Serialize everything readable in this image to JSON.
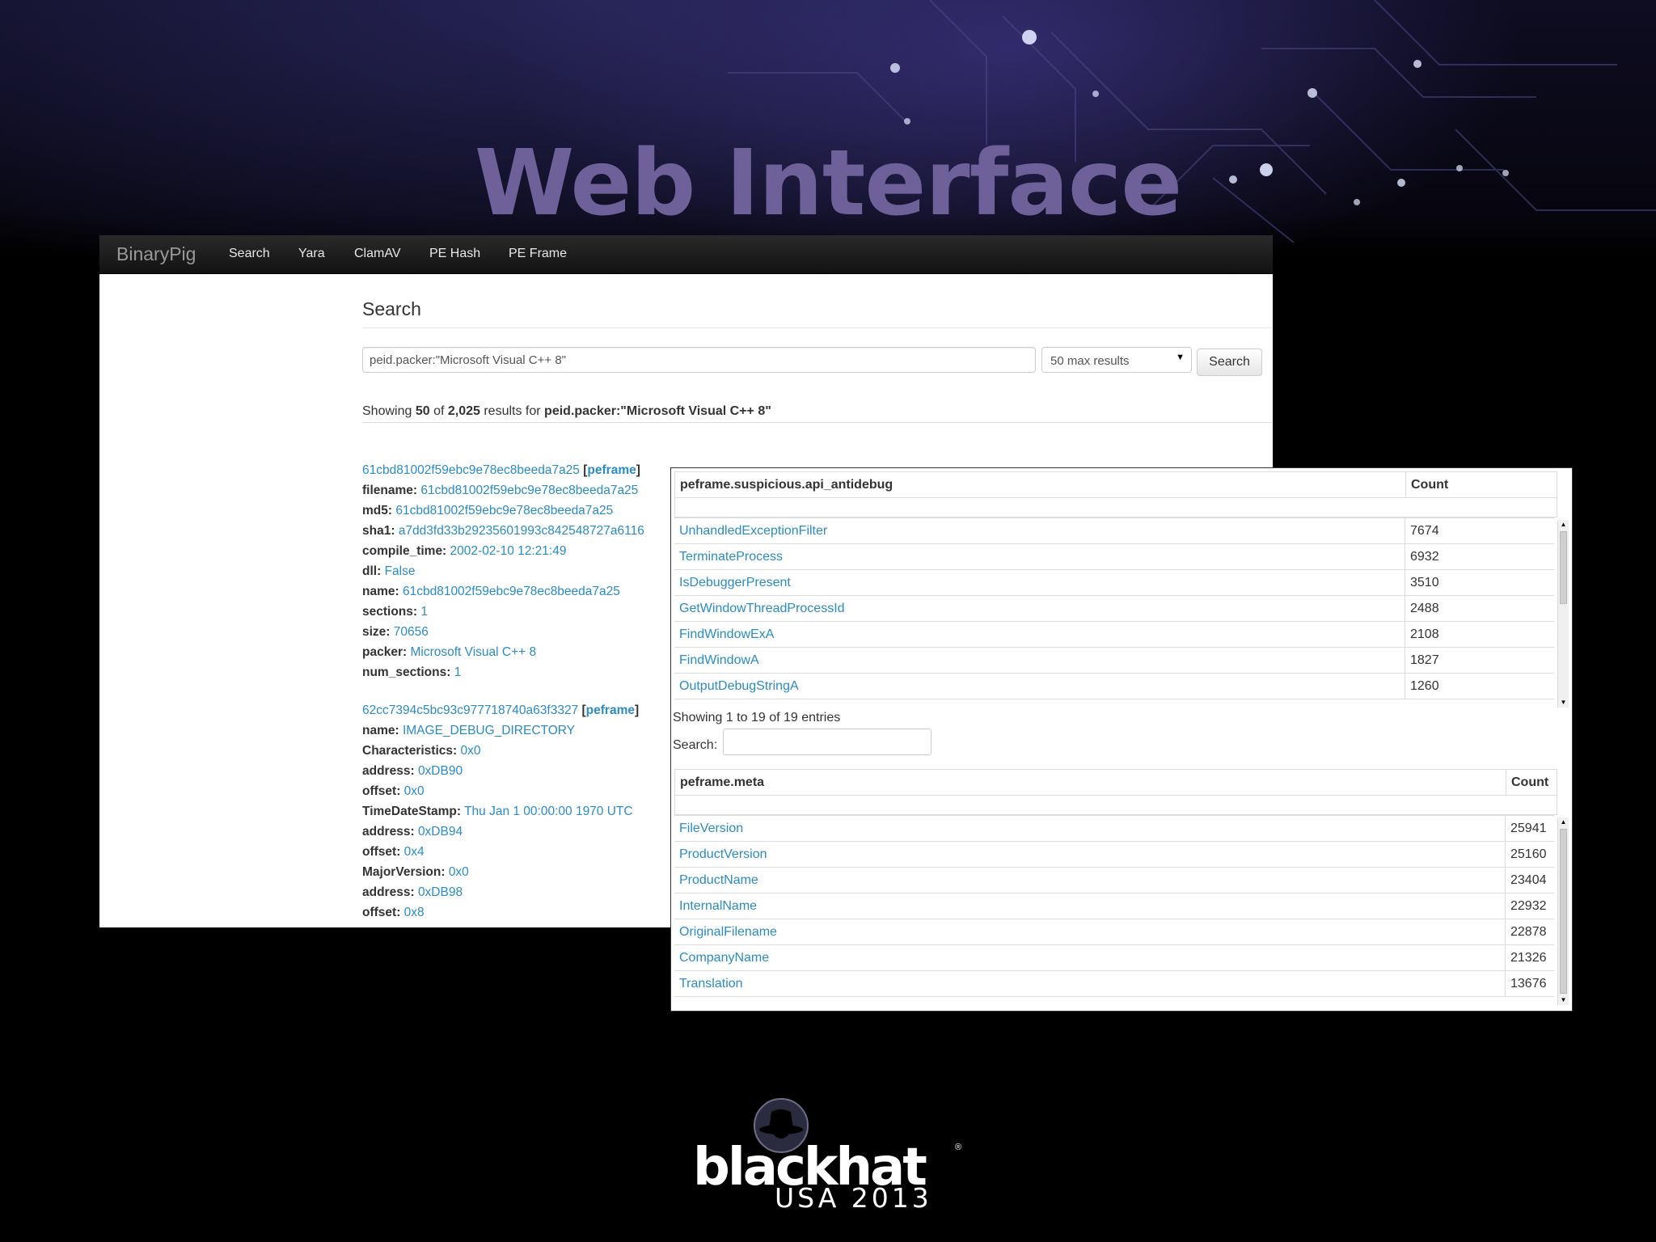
{
  "slide": {
    "title": "Web Interface"
  },
  "navbar": {
    "brand": "BinaryPig",
    "links": [
      "Search",
      "Yara",
      "ClamAV",
      "PE Hash",
      "PE Frame"
    ]
  },
  "search": {
    "heading": "Search",
    "query": "peid.packer:\"Microsoft Visual C++ 8\"",
    "max_results": "50 max results",
    "button": "Search",
    "summary": {
      "prefix": "Showing ",
      "shown": "50",
      "of": " of ",
      "total": "2,025",
      "mid": " results for ",
      "query": "peid.packer:\"Microsoft Visual C++ 8\""
    }
  },
  "records": [
    {
      "id": "61cbd81002f59ebc9e78ec8beeda7a25",
      "tag": "peframe",
      "fields": [
        {
          "k": "filename:",
          "v": "61cbd81002f59ebc9e78ec8beeda7a25"
        },
        {
          "k": "md5:",
          "v": "61cbd81002f59ebc9e78ec8beeda7a25"
        },
        {
          "k": "sha1:",
          "v": "a7dd3fd33b29235601993c842548727a6116"
        },
        {
          "k": "compile_time:",
          "v": "2002-02-10 12:21:49"
        },
        {
          "k": "dll:",
          "v": "False"
        },
        {
          "k": "name:",
          "v": "61cbd81002f59ebc9e78ec8beeda7a25"
        },
        {
          "k": "sections:",
          "v": "1"
        },
        {
          "k": "size:",
          "v": "70656"
        },
        {
          "k": "packer:",
          "v": "Microsoft Visual C++ 8"
        },
        {
          "k": "num_sections:",
          "v": "1"
        }
      ]
    },
    {
      "id": "62cc7394c5bc93c977718740a63f3327",
      "tag": "peframe",
      "fields": [
        {
          "k": "name:",
          "v": "IMAGE_DEBUG_DIRECTORY"
        },
        {
          "k": "Characteristics:",
          "v": "0x0"
        },
        {
          "k": "address:",
          "v": "0xDB90"
        },
        {
          "k": "offset:",
          "v": "0x0"
        },
        {
          "k": "TimeDateStamp:",
          "v": "Thu Jan 1 00:00:00 1970 UTC"
        },
        {
          "k": "address:",
          "v": "0xDB94"
        },
        {
          "k": "offset:",
          "v": "0x4"
        },
        {
          "k": "MajorVersion:",
          "v": "0x0"
        },
        {
          "k": "address:",
          "v": "0xDB98"
        },
        {
          "k": "offset:",
          "v": "0x8"
        }
      ]
    }
  ],
  "antidebug_table": {
    "col_name": "peframe.suspicious.api_antidebug",
    "col_count": "Count",
    "rows": [
      {
        "name": "UnhandledExceptionFilter",
        "count": "7674"
      },
      {
        "name": "TerminateProcess",
        "count": "6932"
      },
      {
        "name": "IsDebuggerPresent",
        "count": "3510"
      },
      {
        "name": "GetWindowThreadProcessId",
        "count": "2488"
      },
      {
        "name": "FindWindowExA",
        "count": "2108"
      },
      {
        "name": "FindWindowA",
        "count": "1827"
      },
      {
        "name": "OutputDebugStringA",
        "count": "1260"
      }
    ],
    "info": "Showing 1 to 19 of 19 entries",
    "search_label": "Search:"
  },
  "meta_table": {
    "col_name": "peframe.meta",
    "col_count": "Count",
    "rows": [
      {
        "name": "FileVersion",
        "count": "25941"
      },
      {
        "name": "ProductVersion",
        "count": "25160"
      },
      {
        "name": "ProductName",
        "count": "23404"
      },
      {
        "name": "InternalName",
        "count": "22932"
      },
      {
        "name": "OriginalFilename",
        "count": "22878"
      },
      {
        "name": "CompanyName",
        "count": "21326"
      },
      {
        "name": "Translation",
        "count": "13676"
      }
    ]
  },
  "logo": {
    "wordmark": "blackhat",
    "edition": "USA 2013",
    "reg": "®"
  },
  "colors": {
    "link": "#2a8bc7",
    "title": "#6e6199",
    "navbar": "#1b1b1b"
  }
}
